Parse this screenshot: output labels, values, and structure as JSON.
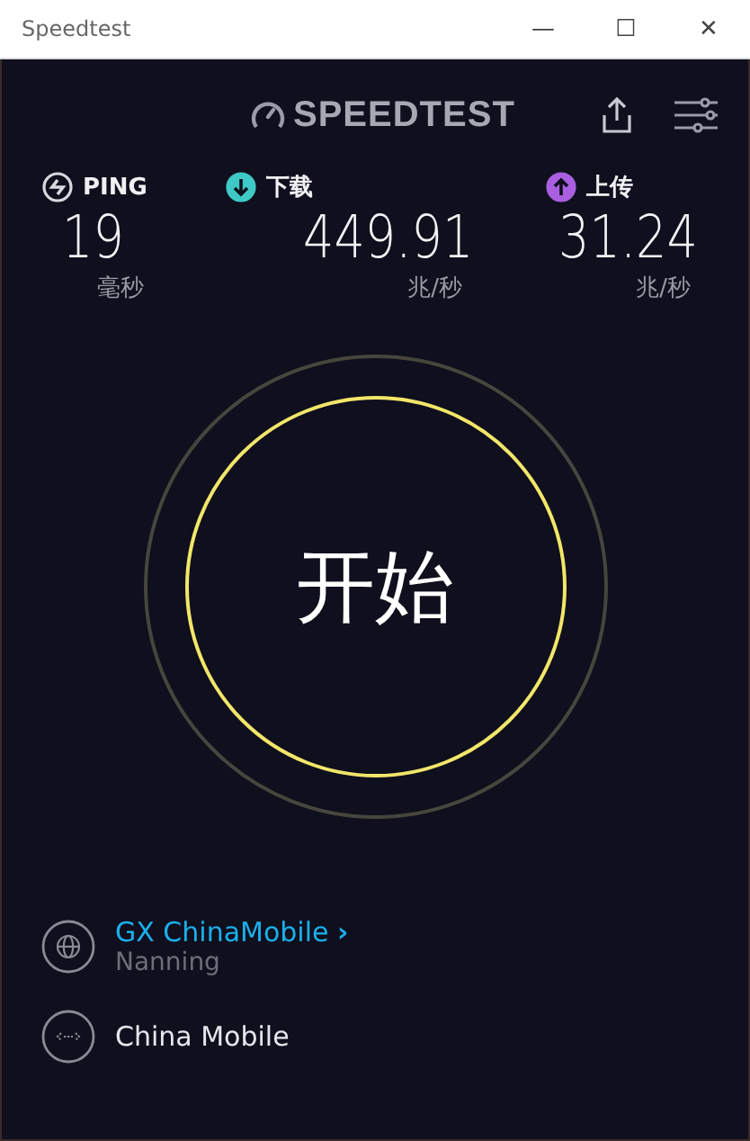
{
  "window": {
    "title": "Speedtest",
    "controls": [
      "—",
      "☐",
      "✕"
    ]
  },
  "header": {
    "logo": "SPEEDTEST"
  },
  "metrics": [
    {
      "kind": "ping",
      "label": "PING",
      "value": "19",
      "unit": "毫秒",
      "color": "#d8d8e0"
    },
    {
      "kind": "download",
      "label": "下载",
      "value": "449.91",
      "unit": "兆/秒",
      "color": "#3ec9c6"
    },
    {
      "kind": "upload",
      "label": "上传",
      "value": "31.24",
      "unit": "兆/秒",
      "color": "#a95fe0"
    }
  ],
  "start_button": {
    "label": "开始"
  },
  "server": {
    "name": "GX ChinaMobile",
    "chevron": "›",
    "location": "Nanning"
  },
  "provider": {
    "name": "China Mobile"
  }
}
